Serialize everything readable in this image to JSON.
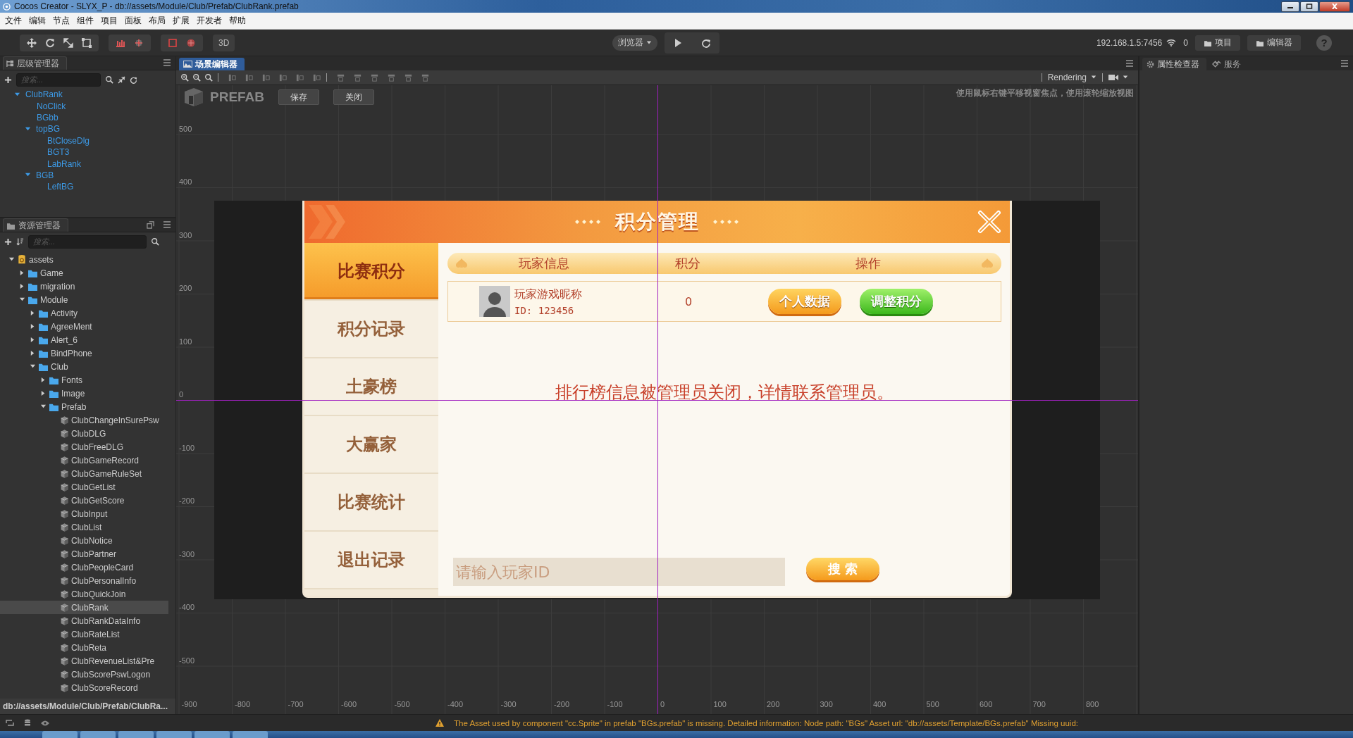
{
  "window": {
    "title": "Cocos Creator - SLYX_P - db://assets/Module/Club/Prefab/ClubRank.prefab"
  },
  "menu": [
    "文件",
    "编辑",
    "节点",
    "组件",
    "项目",
    "面板",
    "布局",
    "扩展",
    "开发者",
    "帮助"
  ],
  "toolbar": {
    "mode_button": "3D",
    "preview": "浏览器",
    "ip": "192.168.1.5:7456",
    "connections": "0",
    "buttons": [
      "项目",
      "编辑器"
    ],
    "help": "?"
  },
  "hierarchy": {
    "title": "层级管理器",
    "search": {
      "placeholder": "搜索..."
    },
    "nodes": [
      {
        "label": "ClubRank",
        "expanded": true,
        "children": [
          {
            "label": "NoClick"
          },
          {
            "label": "BGbb"
          },
          {
            "label": "topBG",
            "expanded": true,
            "children": [
              {
                "label": "BtCloseDlg"
              },
              {
                "label": "BGT3"
              },
              {
                "label": "LabRank"
              }
            ]
          },
          {
            "label": "BGB",
            "expanded": true,
            "children": [
              {
                "label": "LeftBG"
              }
            ]
          }
        ]
      }
    ]
  },
  "assets": {
    "title": "资源管理器",
    "search": {
      "placeholder": "搜索..."
    },
    "tree": [
      {
        "label": "assets",
        "kind": "root",
        "expanded": true,
        "selected": false,
        "children": [
          {
            "label": "Game",
            "kind": "folder",
            "expanded": false,
            "selected": false
          },
          {
            "label": "migration",
            "kind": "folder",
            "expanded": false,
            "selected": false
          },
          {
            "label": "Module",
            "kind": "folder",
            "expanded": true,
            "selected": false,
            "children": [
              {
                "label": "Activity",
                "kind": "folder",
                "expanded": false,
                "selected": false
              },
              {
                "label": "AgreeMent",
                "kind": "folder",
                "expanded": false,
                "selected": false
              },
              {
                "label": "Alert_6",
                "kind": "folder",
                "expanded": false,
                "selected": false
              },
              {
                "label": "BindPhone",
                "kind": "folder",
                "expanded": false,
                "selected": false
              },
              {
                "label": "Club",
                "kind": "folder",
                "expanded": true,
                "selected": false,
                "children": [
                  {
                    "label": "Fonts",
                    "kind": "folder",
                    "expanded": false,
                    "selected": false
                  },
                  {
                    "label": "Image",
                    "kind": "folder",
                    "expanded": false,
                    "selected": false
                  },
                  {
                    "label": "Prefab",
                    "kind": "folder",
                    "expanded": true,
                    "selected": false,
                    "children": [
                      {
                        "label": "ClubChangeInSurePsw",
                        "kind": "prefab",
                        "selected": false
                      },
                      {
                        "label": "ClubDLG",
                        "kind": "prefab",
                        "selected": false
                      },
                      {
                        "label": "ClubFreeDLG",
                        "kind": "prefab",
                        "selected": false
                      },
                      {
                        "label": "ClubGameRecord",
                        "kind": "prefab",
                        "selected": false
                      },
                      {
                        "label": "ClubGameRuleSet",
                        "kind": "prefab",
                        "selected": false
                      },
                      {
                        "label": "ClubGetList",
                        "kind": "prefab",
                        "selected": false
                      },
                      {
                        "label": "ClubGetScore",
                        "kind": "prefab",
                        "selected": false
                      },
                      {
                        "label": "ClubInput",
                        "kind": "prefab",
                        "selected": false
                      },
                      {
                        "label": "ClubList",
                        "kind": "prefab",
                        "selected": false
                      },
                      {
                        "label": "ClubNotice",
                        "kind": "prefab",
                        "selected": false
                      },
                      {
                        "label": "ClubPartner",
                        "kind": "prefab",
                        "selected": false
                      },
                      {
                        "label": "ClubPeopleCard",
                        "kind": "prefab",
                        "selected": false
                      },
                      {
                        "label": "ClubPersonalInfo",
                        "kind": "prefab",
                        "selected": false
                      },
                      {
                        "label": "ClubQuickJoin",
                        "kind": "prefab",
                        "selected": false
                      },
                      {
                        "label": "ClubRank",
                        "kind": "prefab",
                        "selected": true
                      },
                      {
                        "label": "ClubRankDataInfo",
                        "kind": "prefab",
                        "selected": false
                      },
                      {
                        "label": "ClubRateList",
                        "kind": "prefab",
                        "selected": false
                      },
                      {
                        "label": "ClubReta",
                        "kind": "prefab",
                        "selected": false
                      },
                      {
                        "label": "ClubRevenueList&Pre",
                        "kind": "prefab",
                        "selected": false
                      },
                      {
                        "label": "ClubScorePswLogon",
                        "kind": "prefab",
                        "selected": false
                      },
                      {
                        "label": "ClubScoreRecord",
                        "kind": "prefab",
                        "selected": false
                      }
                    ]
                  }
                ]
              }
            ]
          }
        ]
      }
    ],
    "path": "db://assets/Module/Club/Prefab/ClubRa..."
  },
  "scene": {
    "title": "场景编辑器",
    "render_mode": "Rendering",
    "prefab_label": "PREFAB",
    "buttons": [
      "保存",
      "关闭"
    ],
    "hint": "使用鼠标右键平移视窗焦点，使用滚轮缩放视图",
    "y_ticks": [
      "500",
      "400",
      "300",
      "200",
      "100",
      "0",
      "-100",
      "-200",
      "-300",
      "-400",
      "-500"
    ],
    "x_ticks": [
      "-900",
      "-800",
      "-700",
      "-600",
      "-500",
      "-400",
      "-300",
      "-200",
      "-100",
      "0",
      "100",
      "200",
      "300",
      "400",
      "500",
      "600",
      "700",
      "800"
    ],
    "dialog": {
      "title": "积分管理",
      "tabs": [
        {
          "label": "比赛积分",
          "selected": true
        },
        {
          "label": "积分记录",
          "selected": false
        },
        {
          "label": "土豪榜",
          "selected": false
        },
        {
          "label": "大赢家",
          "selected": false
        },
        {
          "label": "比赛统计",
          "selected": false
        },
        {
          "label": "退出记录",
          "selected": false
        }
      ],
      "columns": [
        "玩家信息",
        "积分",
        "操作"
      ],
      "rows": [
        {
          "name": "玩家游戏昵称",
          "id": "ID: 123456",
          "score": "0",
          "actions": [
            {
              "label": "个人数据",
              "kind": "primary"
            },
            {
              "label": "调整积分",
              "kind": "success"
            }
          ]
        }
      ],
      "notice": "排行榜信息被管理员关闭，详情联系管理员。",
      "search": {
        "placeholder": "请输入玩家ID",
        "button": "搜 索"
      }
    }
  },
  "inspector": {
    "tabs": [
      {
        "label": "属性检查器",
        "selected": true
      },
      {
        "label": "服务",
        "selected": false
      }
    ]
  },
  "status_bar": {
    "message": "The Asset used by component \"cc.Sprite\" in prefab \"BGs.prefab\" is missing. Detailed information: Node path: \"BGs\" Asset url: \"db://assets/Template/BGs.prefab\" Missing uuid:"
  }
}
